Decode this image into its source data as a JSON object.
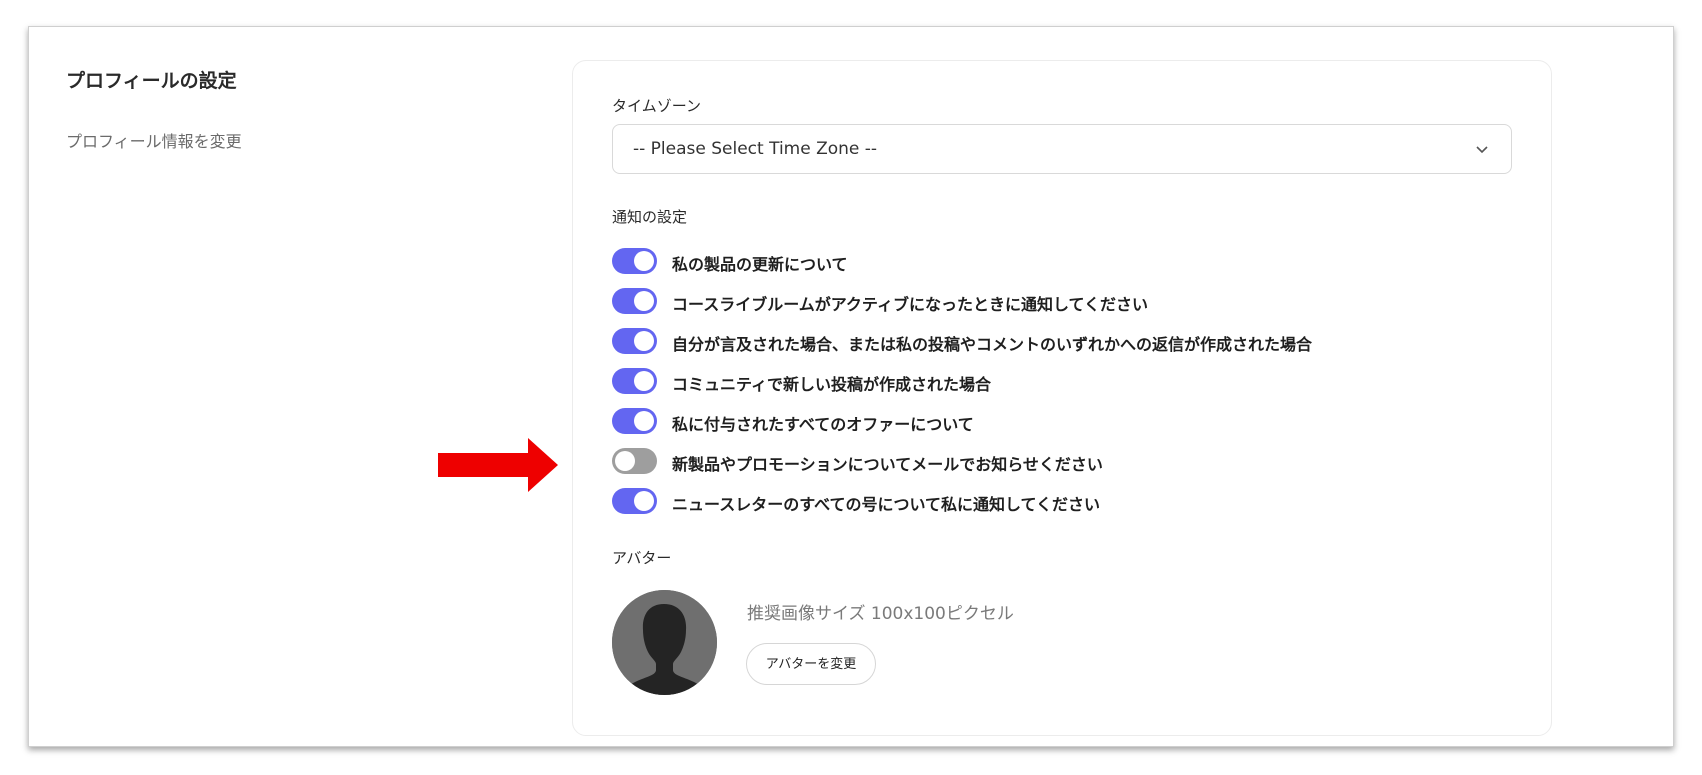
{
  "profile": {
    "title": "プロフィールの設定",
    "description": "プロフィール情報を変更"
  },
  "timezone": {
    "label": "タイムゾーン",
    "selected": "-- Please Select Time Zone --"
  },
  "notifications": {
    "label": "通知の設定",
    "items": [
      {
        "label": "私の製品の更新について",
        "enabled": true
      },
      {
        "label": "コースライブルームがアクティブになったときに通知してください",
        "enabled": true
      },
      {
        "label": "自分が言及された場合、または私の投稿やコメントのいずれかへの返信が作成された場合",
        "enabled": true
      },
      {
        "label": "コミュニティで新しい投稿が作成された場合",
        "enabled": true
      },
      {
        "label": "私に付与されたすべてのオファーについて",
        "enabled": true
      },
      {
        "label": "新製品やプロモーションについてメールでお知らせください",
        "enabled": false
      },
      {
        "label": "ニュースレターのすべての号について私に通知してください",
        "enabled": true
      }
    ]
  },
  "avatar": {
    "label": "アバター",
    "hint": "推奨画像サイズ 100x100ピクセル",
    "change_button": "アバターを変更"
  },
  "colors": {
    "toggle_on": "#6366f1",
    "toggle_off": "#9e9e9e",
    "annotation_arrow": "#ee0000"
  }
}
